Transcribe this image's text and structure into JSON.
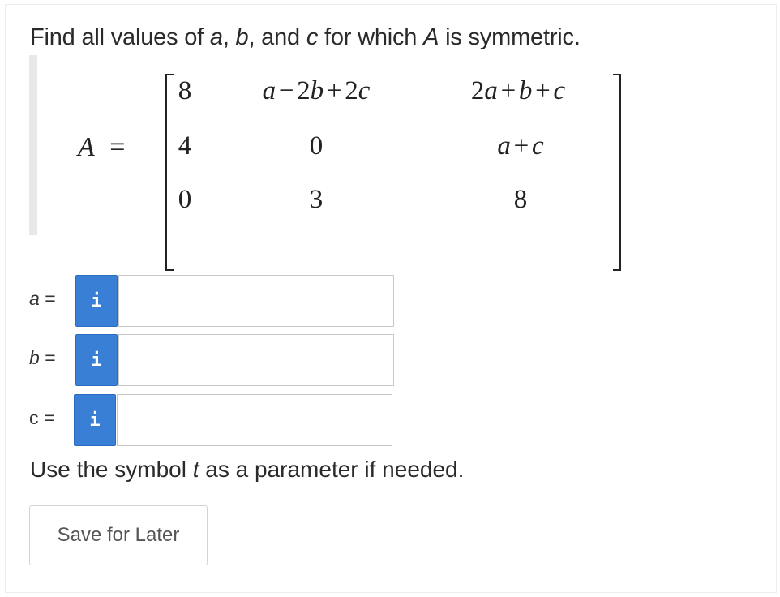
{
  "question": {
    "parts": [
      "Find all values of ",
      "a",
      ", ",
      "b",
      ", and ",
      "c",
      " for which ",
      "A",
      " is symmetric."
    ]
  },
  "matrix": {
    "lhs_var": "A",
    "lhs_eq": "=",
    "rows": [
      [
        "8",
        "a − 2b + 2c",
        "2a + b + c"
      ],
      [
        "4",
        "0",
        "a + c"
      ],
      [
        "0",
        "3",
        "8"
      ]
    ]
  },
  "answers": [
    {
      "label": "a",
      "eq": "=",
      "value": "",
      "info_icon": "info-icon",
      "info_glyph": "i"
    },
    {
      "label": "b",
      "eq": "=",
      "value": "",
      "info_icon": "info-icon",
      "info_glyph": "i"
    },
    {
      "label": "c",
      "eq": "=",
      "value": "",
      "info_icon": "info-icon",
      "info_glyph": "i"
    }
  ],
  "hint": {
    "parts": [
      "Use the symbol ",
      "t",
      " as a parameter if needed."
    ]
  },
  "save_button": {
    "label": "Save for Later"
  },
  "colors": {
    "info_button": "#3a7fd6",
    "border": "#c8c8c8",
    "math_bar": "#e8e8e8"
  }
}
